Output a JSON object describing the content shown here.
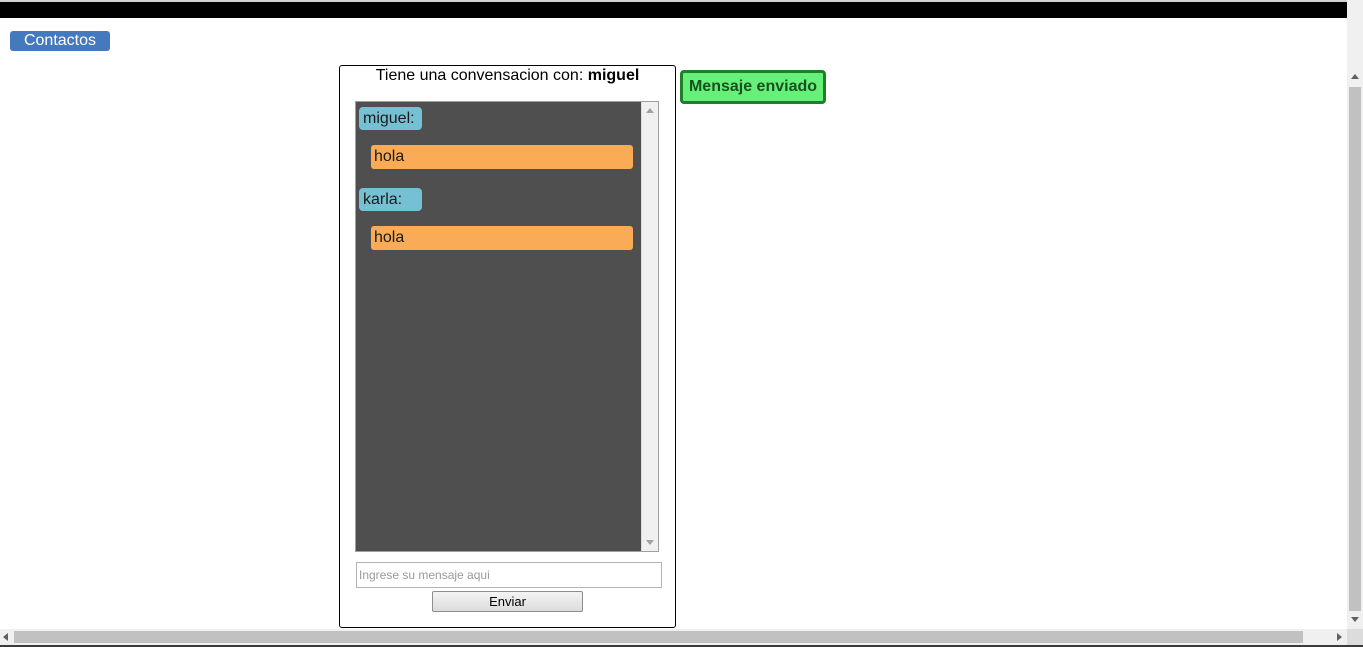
{
  "nav": {
    "contacts_label": "Contactos"
  },
  "chat": {
    "title_prefix": "Tiene una convensacion con:",
    "partner_name": "miguel",
    "messages": [
      {
        "sender": "miguel:",
        "text": "hola"
      },
      {
        "sender": "karla:",
        "text": "hola"
      }
    ],
    "input_placeholder": "Ingrese su mensaje aqui",
    "input_value": "",
    "send_label": "Enviar"
  },
  "status": {
    "sent_label": "Mensaje enviado"
  },
  "colors": {
    "nav_button": "#4479bd",
    "sender_bubble": "#75c1d3",
    "message_bubble": "#f9ab55",
    "messages_background": "#4f4f4f",
    "status_background": "#66f07a",
    "status_border": "#1e7e2a"
  }
}
